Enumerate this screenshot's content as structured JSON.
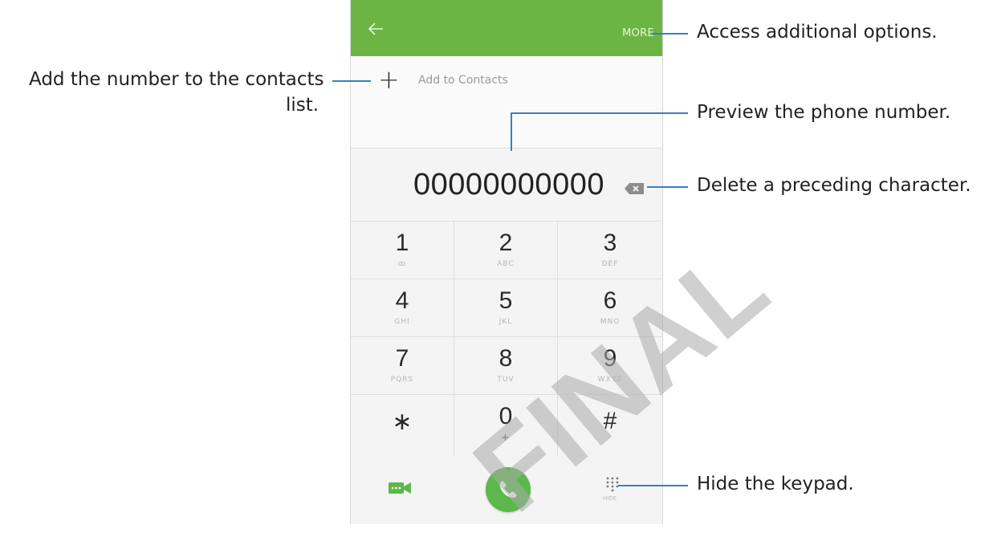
{
  "app_bar": {
    "back_icon": "arrow-left-icon",
    "more_label": "MORE"
  },
  "add_contact": {
    "icon": "plus-icon",
    "label": "Add to Contacts"
  },
  "dial": {
    "number": "00000000000",
    "delete_icon": "backspace-icon"
  },
  "keypad": {
    "keys": [
      {
        "digit": "1",
        "sub": "ꝏ"
      },
      {
        "digit": "2",
        "sub": "ABC"
      },
      {
        "digit": "3",
        "sub": "DEF"
      },
      {
        "digit": "4",
        "sub": "GHI"
      },
      {
        "digit": "5",
        "sub": "JKL"
      },
      {
        "digit": "6",
        "sub": "MNO"
      },
      {
        "digit": "7",
        "sub": "PQRS"
      },
      {
        "digit": "8",
        "sub": "TUV"
      },
      {
        "digit": "9",
        "sub": "WXYZ"
      },
      {
        "digit": "∗",
        "sub": ""
      },
      {
        "digit": "0",
        "sub": "+"
      },
      {
        "digit": "#",
        "sub": ""
      }
    ]
  },
  "actions": {
    "video_icon": "video-call-icon",
    "call_icon": "phone-call-icon",
    "hide_icon": "keypad-hide-icon",
    "hide_label": "HIDE"
  },
  "colors": {
    "app_bar": "#6cb545",
    "call_button": "#5cb84a",
    "callout_line": "#3a7fc1"
  },
  "callouts": {
    "more": "Access additional options.",
    "add_line1": "Add the number to the contacts",
    "add_line2": "list.",
    "preview": "Preview the phone number.",
    "delete": "Delete a preceding character.",
    "hide": "Hide the keypad."
  },
  "watermark": "FINAL"
}
